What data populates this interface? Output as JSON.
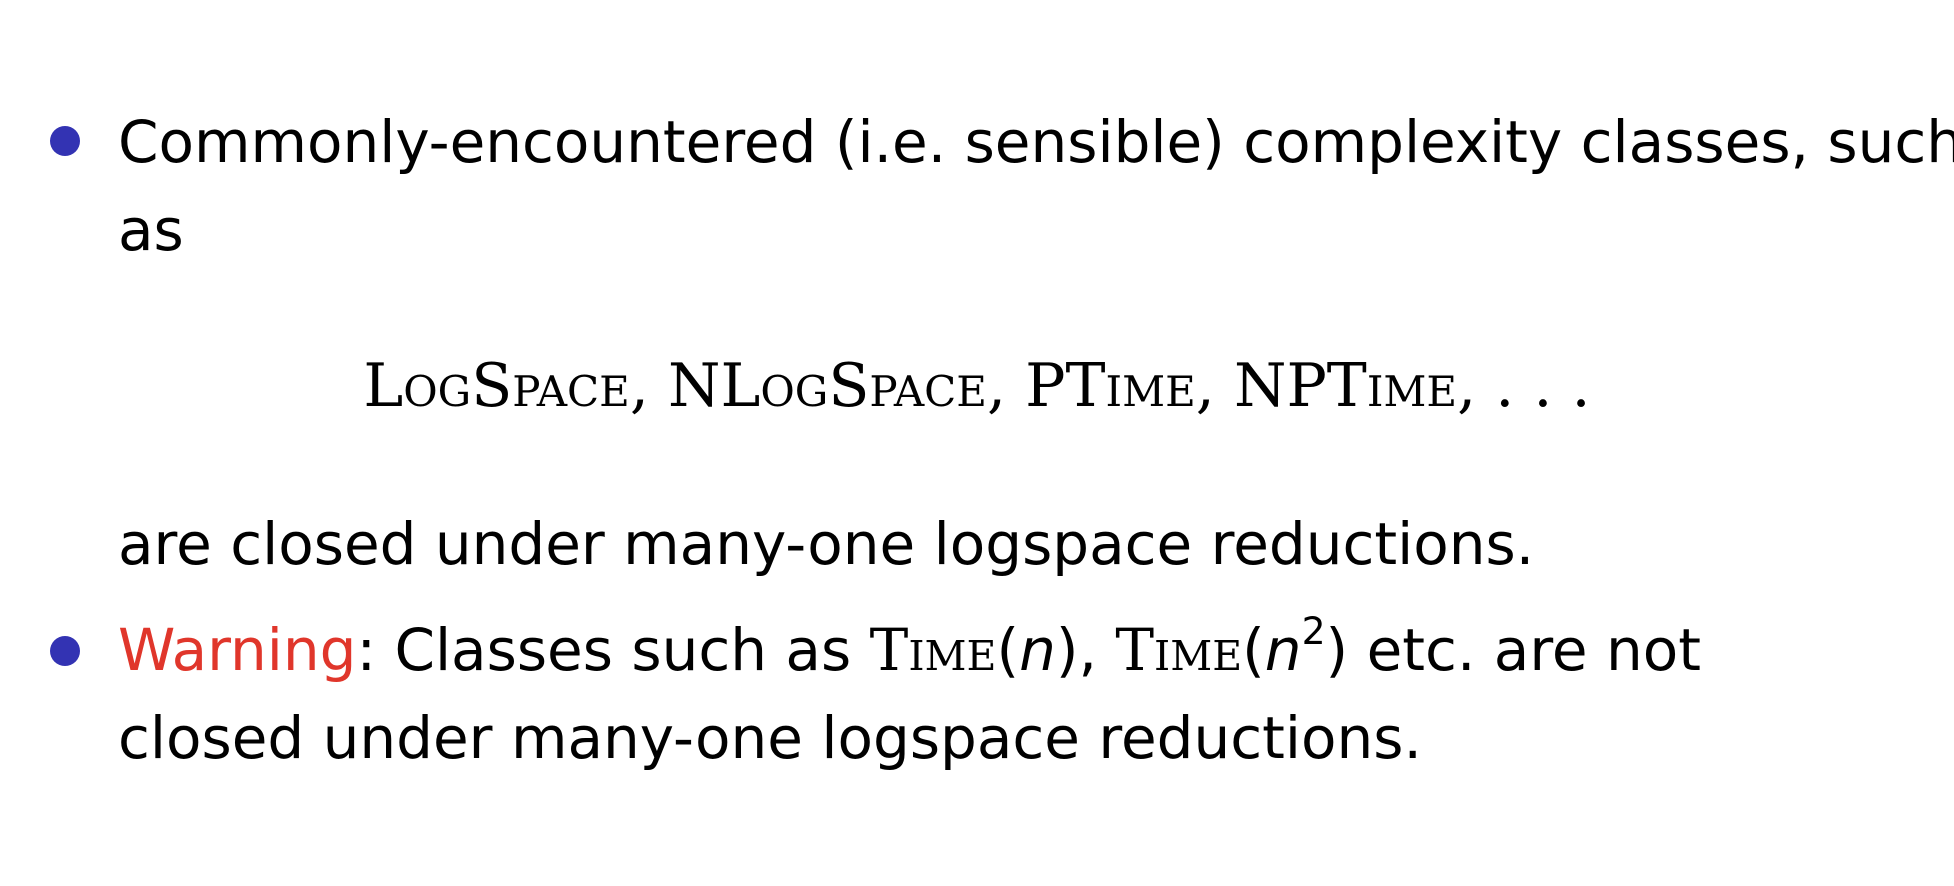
{
  "bullet1": {
    "line1": "Commonly-encountered (i.e. sensible) complexity classes, such",
    "line2": "as",
    "classes": [
      "LogSpace",
      "NLogSpace",
      "PTime",
      "NPTime"
    ],
    "separator": ", ",
    "ellipsis": ". . .",
    "line3": "are closed under many-one logspace reductions."
  },
  "bullet2": {
    "warning": "Warning",
    "after_warning": ": Classes such as ",
    "time_label": "Time",
    "arg1": "n",
    "arg2": "n",
    "exponent": "2",
    "after_classes": " etc. are not",
    "line2": "closed under many-one logspace reductions."
  },
  "colors": {
    "bullet": "#3333b3",
    "warning": "#e0362b",
    "text": "#000000"
  }
}
